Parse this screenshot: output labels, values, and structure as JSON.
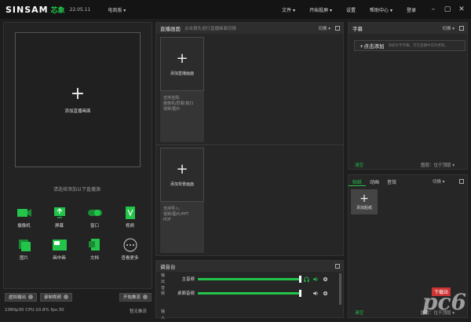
{
  "titlebar": {
    "logo": "SINSAM",
    "logo_cn": "芯象",
    "version": "22.05.11",
    "mode": "电商版",
    "menu": [
      "文件",
      "开始投屏",
      "设置",
      "帮助中心",
      "登录"
    ]
  },
  "left": {
    "preview_add_label": "添加直播画面",
    "hint": "请选择添加以下直播源",
    "sources": [
      {
        "label": "摄像机",
        "icon": "camera-icon"
      },
      {
        "label": "屏幕",
        "icon": "screen-icon"
      },
      {
        "label": "窗口",
        "icon": "window-icon"
      },
      {
        "label": "视频",
        "icon": "video-icon"
      },
      {
        "label": "图片",
        "icon": "image-icon"
      },
      {
        "label": "画中画",
        "icon": "pip-icon"
      },
      {
        "label": "文档",
        "icon": "document-icon"
      },
      {
        "label": "查看更多",
        "icon": "more-icon"
      }
    ],
    "virtual_output": "虚拟输出",
    "record_video": "录制视频",
    "start_stream": "开始推流",
    "status": "1080p30  CPU:10.8%  fps:30",
    "stream_state": "暂无推流"
  },
  "scenes": {
    "title": "直播画面",
    "subtitle": "点击镜头进行直播画面切换",
    "switch_label": "切换",
    "card1_add": "添加直播画面",
    "card1_desc": "支持选择:\n摄像机/屏幕/窗口\n视频/图片",
    "card2_add": "添加背景画面",
    "card2_desc": "支持导入:\n视频/图片/PPT\nPDF"
  },
  "mixer": {
    "title": "调音台",
    "side": "输出音频",
    "side_bottom": "输入",
    "rows": [
      {
        "label": "主音频",
        "level": 1.0
      },
      {
        "label": "桌面音频",
        "level": 1.0
      }
    ]
  },
  "subtitle_panel": {
    "title": "字幕",
    "switch_label": "切换",
    "add": "+点击添加",
    "add_hint": "添加文字字幕，可在直播中实时更新。",
    "clear": "清空",
    "layer": "图层：位于顶层"
  },
  "sticker_panel": {
    "tabs": [
      "贴纸",
      "动画",
      "音效"
    ],
    "active_tab": 0,
    "switch_label": "切换",
    "add": "添加贴纸",
    "clear": "清空",
    "layer": "图层：位于顶层"
  },
  "watermark": {
    "text": "pc6",
    "tag": "下载站"
  },
  "colors": {
    "accent": "#22c44a",
    "bg": "#1e1e1e",
    "panel": "#262626"
  }
}
